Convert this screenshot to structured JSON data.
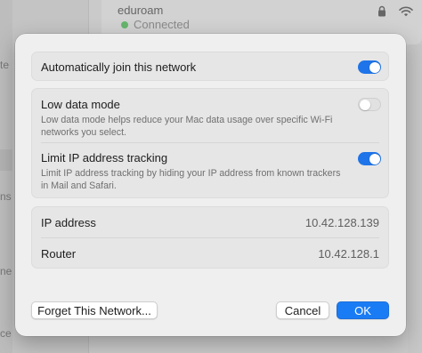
{
  "background": {
    "sidebar_fragments": [
      "te",
      "ns",
      "ne",
      "ce"
    ],
    "network": {
      "name": "eduroam",
      "status": "Connected",
      "icons": [
        "lock-icon",
        "wifi-icon"
      ]
    }
  },
  "dialog": {
    "auto_join": {
      "label": "Automatically join this network",
      "enabled": true
    },
    "low_data_mode": {
      "label": "Low data mode",
      "description": "Low data mode helps reduce your Mac data usage over specific Wi-Fi networks you select.",
      "enabled": false
    },
    "limit_ip_tracking": {
      "label": "Limit IP address tracking",
      "description": "Limit IP address tracking by hiding your IP address from known trackers in Mail and Safari.",
      "enabled": true
    },
    "info": [
      {
        "key": "IP address",
        "value": "10.42.128.139"
      },
      {
        "key": "Router",
        "value": "10.42.128.1"
      }
    ],
    "buttons": {
      "forget": "Forget This Network...",
      "cancel": "Cancel",
      "ok": "OK"
    }
  },
  "colors": {
    "accent": "#1a7cf4",
    "toggle_on": "#1e74e8",
    "connected_dot": "#67b56d"
  }
}
